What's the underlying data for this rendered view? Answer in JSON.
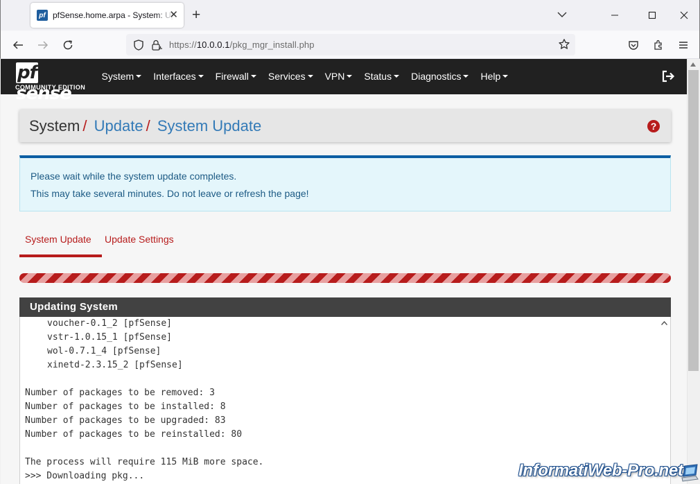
{
  "browser": {
    "tab_title": "pfSense.home.arpa - System: Update",
    "url_prefix": "https://",
    "url_host": "10.0.0.1",
    "url_path": "/pkg_mgr_install.php"
  },
  "pfsense": {
    "logo_text": "sense",
    "logo_pf": "pf",
    "logo_subtitle": "COMMUNITY EDITION",
    "menu": [
      "System",
      "Interfaces",
      "Firewall",
      "Services",
      "VPN",
      "Status",
      "Diagnostics",
      "Help"
    ]
  },
  "breadcrumb": {
    "root": "System",
    "sep": "/",
    "item1": "Update",
    "item2": "System Update",
    "help_symbol": "?"
  },
  "alert": {
    "line1": "Please wait while the system update completes.",
    "line2": "This may take several minutes. Do not leave or refresh the page!"
  },
  "tabs": {
    "system_update": "System Update",
    "update_settings": "Update Settings"
  },
  "panel": {
    "title": "Updating System",
    "log": [
      {
        "text": "voucher-0.1_2 [pfSense]",
        "indent": true
      },
      {
        "text": "vstr-1.0.15_1 [pfSense]",
        "indent": true
      },
      {
        "text": "wol-0.7.1_4 [pfSense]",
        "indent": true
      },
      {
        "text": "xinetd-2.3.15_2 [pfSense]",
        "indent": true
      },
      {
        "text": "",
        "indent": false
      },
      {
        "text": "Number of packages to be removed: 3",
        "indent": false
      },
      {
        "text": "Number of packages to be installed: 8",
        "indent": false
      },
      {
        "text": "Number of packages to be upgraded: 83",
        "indent": false
      },
      {
        "text": "Number of packages to be reinstalled: 80",
        "indent": false
      },
      {
        "text": "",
        "indent": false
      },
      {
        "text": "The process will require 115 MiB more space.",
        "indent": false
      },
      {
        "text": ">>> Downloading pkg...",
        "indent": false
      }
    ]
  },
  "watermark": "InformatiWeb-Pro.net",
  "colors": {
    "accent_red": "#b71c1c",
    "link_blue": "#337ab7",
    "nav_dark": "#212121"
  }
}
